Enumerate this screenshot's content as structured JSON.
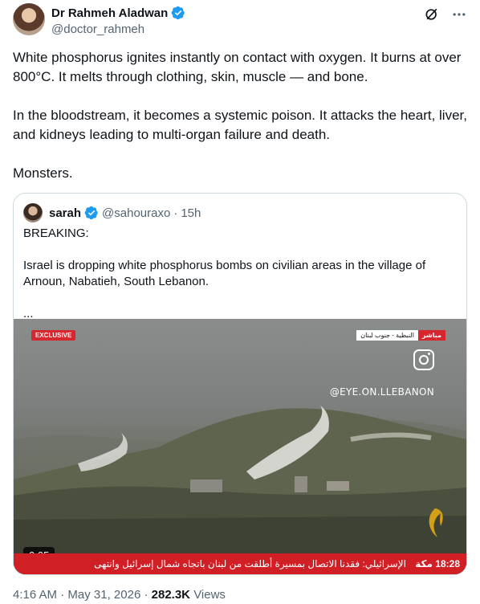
{
  "author": {
    "display_name": "Dr Rahmeh Aladwan",
    "handle": "@doctor_rahmeh"
  },
  "tweet": {
    "paragraphs": [
      "White phosphorus ignites instantly on contact with oxygen. It burns at over 800°C. It melts through clothing, skin, muscle — and bone.",
      "In the bloodstream, it becomes a systemic poison. It attacks the heart, liver, and kidneys leading to multi-organ failure and death.",
      "Monsters."
    ]
  },
  "quote": {
    "display_name": "sarah",
    "handle": "@sahouraxo",
    "separator": "·",
    "time": "15h",
    "paragraphs": [
      "BREAKING:",
      "Israel is dropping white phosphorus bombs on civilian areas in the village of Arnoun, Nabatieh, South Lebanon.",
      "..."
    ],
    "video": {
      "exclusive_label": "EXCLUSIVE",
      "location_label": "النبطية - جنوب لبنان",
      "live_label": "مباشر",
      "watermark": "@EYE.ON.LLEBANON",
      "ticker_text": "الإسرائيلي: فقدنا الاتصال بمسيرة أطلقت من لبنان باتجاه شمال إسرائيل وانتهى",
      "ticker_time": "18:28 مكة",
      "duration": "0:05"
    }
  },
  "footer": {
    "time": "4:16 AM",
    "sep1": "·",
    "date": "May 31, 2026",
    "sep2": "·",
    "views_count": "282.3K",
    "views_label": "Views"
  },
  "colors": {
    "verified": "#1d9bf0",
    "text": "#0f1419",
    "secondary": "#536471",
    "border": "#cfd9de"
  },
  "icons": [
    "verified-badge-icon",
    "grok-icon",
    "more-icon",
    "instagram-icon",
    "al-jazeera-logo"
  ]
}
